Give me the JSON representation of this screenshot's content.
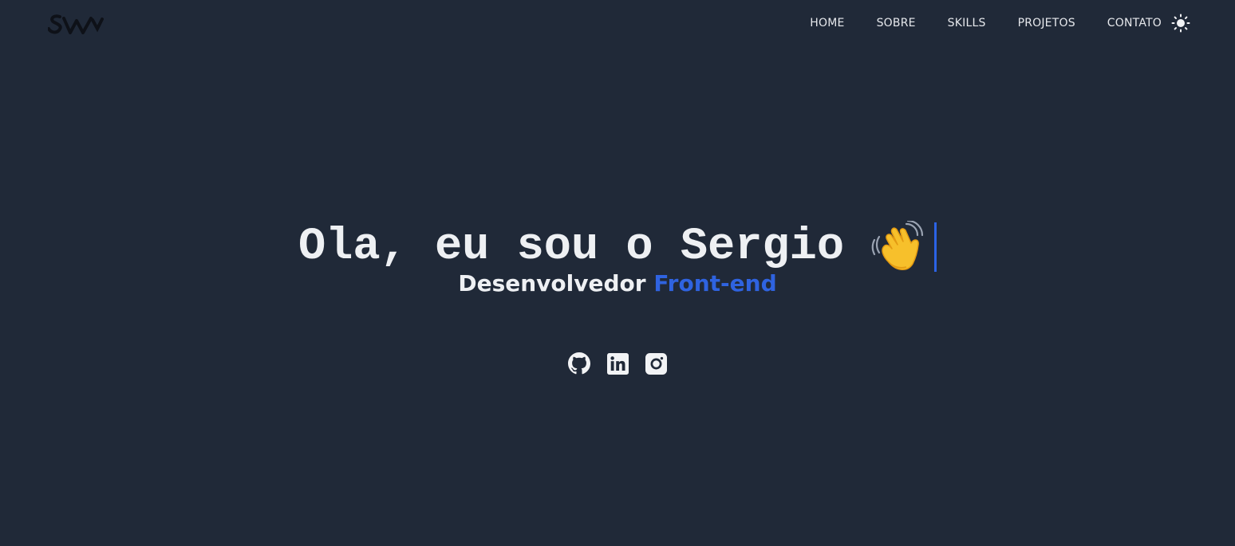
{
  "header": {
    "logo_alt": "SW",
    "nav": [
      {
        "label": "HOME"
      },
      {
        "label": "SOBRE"
      },
      {
        "label": "SKILLS"
      },
      {
        "label": "PROJETOS"
      },
      {
        "label": "CONTATO"
      }
    ],
    "theme_icon": "sun-icon"
  },
  "hero": {
    "greeting": "Ola, eu sou o Sergio",
    "emoji": "waving-hand-icon",
    "subtitle_prefix": "Desenvolvedor",
    "subtitle_accent": "Front-end"
  },
  "socials": [
    {
      "icon": "github-icon"
    },
    {
      "icon": "linkedin-icon"
    },
    {
      "icon": "instagram-icon"
    }
  ],
  "colors": {
    "background": "#202938",
    "text": "#eef0f3",
    "accent": "#2f63e0"
  }
}
